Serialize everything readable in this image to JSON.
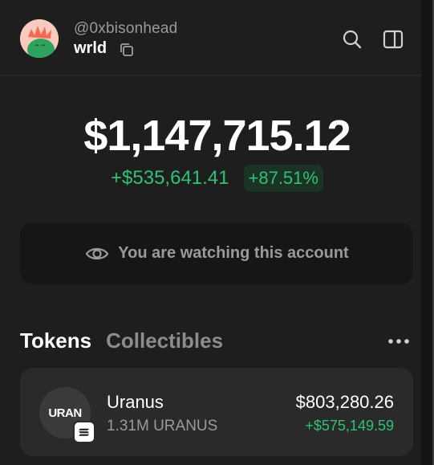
{
  "account": {
    "handle": "@0xbisonhead",
    "wallet_name": "wrld"
  },
  "balance": {
    "total": "$1,147,715.12",
    "change_amount": "+$535,641.41",
    "change_percent": "+87.51%"
  },
  "watch_notice": {
    "text": "You are watching this account",
    "icon": "eye-icon"
  },
  "tabs": [
    {
      "label": "Tokens",
      "active": true
    },
    {
      "label": "Collectibles",
      "active": false
    }
  ],
  "tokens": [
    {
      "logo_text": "URAN",
      "name": "Uranus",
      "amount": "1.31M URANUS",
      "value": "$803,280.26",
      "change": "+$575,149.59",
      "chain_icon": "solana-icon"
    }
  ],
  "colors": {
    "background": "#1e1e1e",
    "positive": "#2ec276",
    "positive_bg": "#1a3325",
    "muted_text": "#9a9a9a",
    "card": "#2a2a2a"
  }
}
